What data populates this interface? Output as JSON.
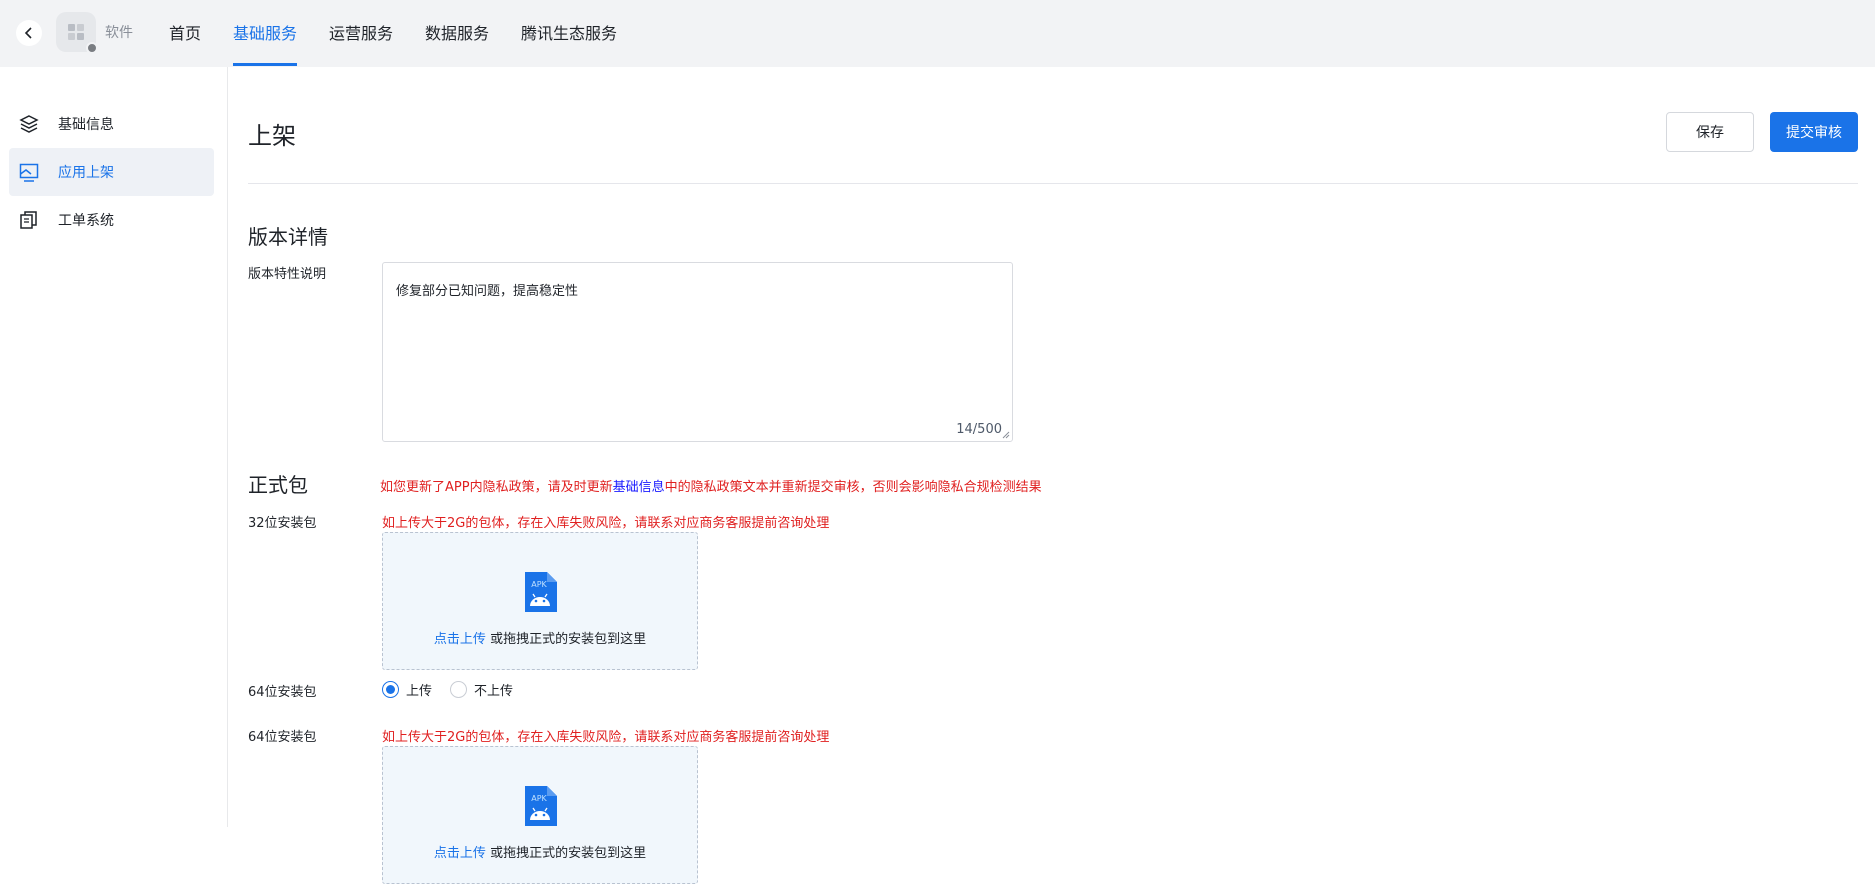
{
  "topbar": {
    "app_name": "软件",
    "tabs": [
      {
        "label": "首页",
        "active": false
      },
      {
        "label": "基础服务",
        "active": true
      },
      {
        "label": "运营服务",
        "active": false
      },
      {
        "label": "数据服务",
        "active": false
      },
      {
        "label": "腾讯生态服务",
        "active": false
      }
    ]
  },
  "sidebar": {
    "items": [
      {
        "label": "基础信息",
        "icon": "layers-icon",
        "active": false
      },
      {
        "label": "应用上架",
        "icon": "image-frame-icon",
        "active": true
      },
      {
        "label": "工单系统",
        "icon": "documents-icon",
        "active": false
      }
    ]
  },
  "page": {
    "title": "上架",
    "save_label": "保存",
    "submit_label": "提交审核"
  },
  "version": {
    "section_title": "版本详情",
    "field_label": "版本特性说明",
    "value": "修复部分已知问题，提高稳定性",
    "counter": "14/500"
  },
  "package": {
    "section_title": "正式包",
    "privacy_notice_pre": "如您更新了APP内隐私政策，请及时更新",
    "privacy_notice_link": "基础信息",
    "privacy_notice_post": "中的隐私政策文本并重新提交审核，否则会影响隐私合规检测结果",
    "pkg32_label": "32位安装包",
    "size_warning": "如上传大于2G的包体，存在入库失败风险，请联系对应商务客服提前咨询处理",
    "apk_label": "APK",
    "upload_click": "点击上传",
    "upload_rest": " 或拖拽正式的安装包到这里",
    "pkg64_toggle_label": "64位安装包",
    "radio_upload": "上传",
    "radio_no_upload": "不上传",
    "radio_selected": "上传",
    "pkg64_label": "64位安装包"
  },
  "colors": {
    "accent": "#1a73e8",
    "warning": "#e02020",
    "upload_bg": "#f1f7fc"
  }
}
